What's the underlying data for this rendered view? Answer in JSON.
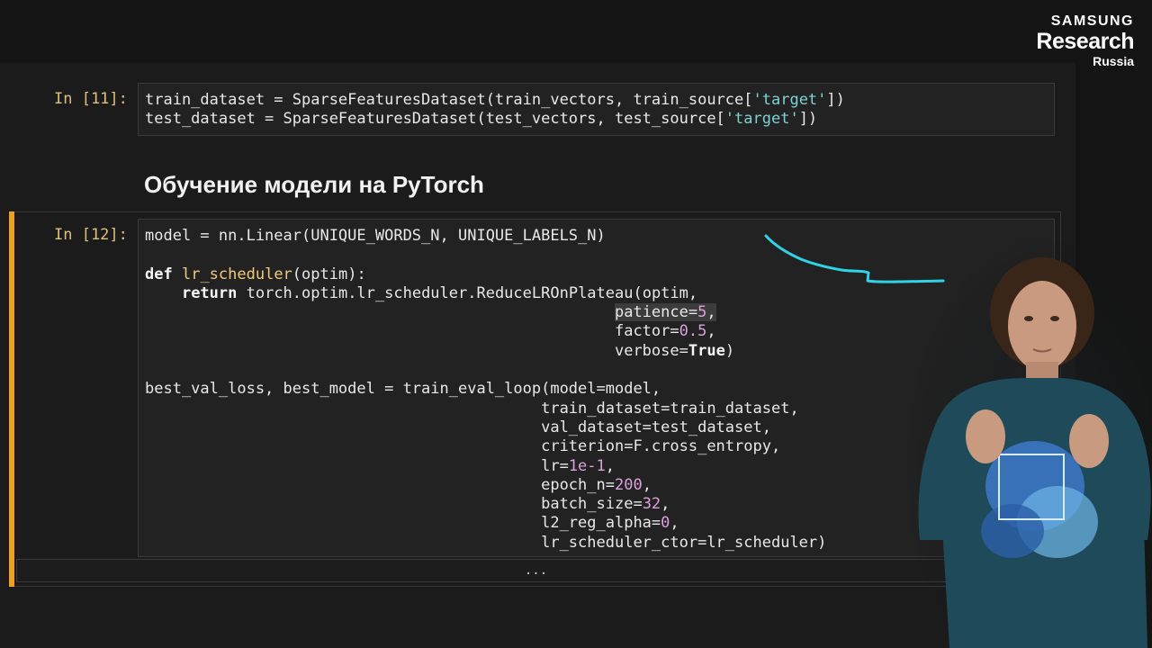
{
  "logo": {
    "line1": "SAMSUNG",
    "line2": "Research",
    "line3": "Russia"
  },
  "cell11": {
    "prompt": "In [11]:",
    "lines": [
      {
        "parts": [
          [
            "t",
            "train_dataset = SparseFeaturesDataset(train_vectors, train_source["
          ],
          [
            "str",
            "'target'"
          ],
          [
            "t",
            "])"
          ]
        ]
      },
      {
        "parts": [
          [
            "t",
            "test_dataset = SparseFeaturesDataset(test_vectors, test_source["
          ],
          [
            "str",
            "'target'"
          ],
          [
            "t",
            "])"
          ]
        ]
      }
    ]
  },
  "heading": "Обучение модели на PyTorch",
  "cell12": {
    "prompt": "In [12]:",
    "lines": [
      {
        "parts": [
          [
            "t",
            "model = nn.Linear(UNIQUE_WORDS_N, UNIQUE_LABELS_N)"
          ]
        ]
      },
      {
        "parts": []
      },
      {
        "parts": [
          [
            "kw",
            "def"
          ],
          [
            "t",
            " "
          ],
          [
            "fn",
            "lr_scheduler"
          ],
          [
            "t",
            "(optim):"
          ]
        ]
      },
      {
        "parts": [
          [
            "t",
            "    "
          ],
          [
            "kw",
            "return"
          ],
          [
            "t",
            " torch.optim.lr_scheduler.ReduceLROnPlateau(optim,"
          ]
        ]
      },
      {
        "parts": [
          [
            "t",
            "                                                   "
          ],
          [
            "hl",
            "patience="
          ],
          [
            "hlnum",
            "5"
          ],
          [
            "hl",
            ","
          ]
        ]
      },
      {
        "parts": [
          [
            "t",
            "                                                   factor="
          ],
          [
            "num",
            "0.5"
          ],
          [
            "t",
            ","
          ]
        ]
      },
      {
        "parts": [
          [
            "t",
            "                                                   verbose="
          ],
          [
            "kw",
            "True"
          ],
          [
            "t",
            ")"
          ]
        ]
      },
      {
        "parts": []
      },
      {
        "parts": [
          [
            "t",
            "best_val_loss, best_model = train_eval_loop(model=model,"
          ]
        ]
      },
      {
        "parts": [
          [
            "t",
            "                                           train_dataset=train_dataset,"
          ]
        ]
      },
      {
        "parts": [
          [
            "t",
            "                                           val_dataset=test_dataset,"
          ]
        ]
      },
      {
        "parts": [
          [
            "t",
            "                                           criterion=F.cross_entropy,"
          ]
        ]
      },
      {
        "parts": [
          [
            "t",
            "                                           lr="
          ],
          [
            "num",
            "1e-1"
          ],
          [
            "t",
            ","
          ]
        ]
      },
      {
        "parts": [
          [
            "t",
            "                                           epoch_n="
          ],
          [
            "num",
            "200"
          ],
          [
            "t",
            ","
          ]
        ]
      },
      {
        "parts": [
          [
            "t",
            "                                           batch_size="
          ],
          [
            "num",
            "32"
          ],
          [
            "t",
            ","
          ]
        ]
      },
      {
        "parts": [
          [
            "t",
            "                                           l2_reg_alpha="
          ],
          [
            "num",
            "0"
          ],
          [
            "t",
            ","
          ]
        ]
      },
      {
        "parts": [
          [
            "t",
            "                                           lr_scheduler_ctor=lr_scheduler)"
          ]
        ]
      }
    ]
  },
  "output_collapsed": "...",
  "colors": {
    "accent": "#f0a020",
    "pen": "#2fd3e6",
    "string": "#7fd1d6",
    "number": "#dda0dd",
    "function": "#f2c97d"
  }
}
